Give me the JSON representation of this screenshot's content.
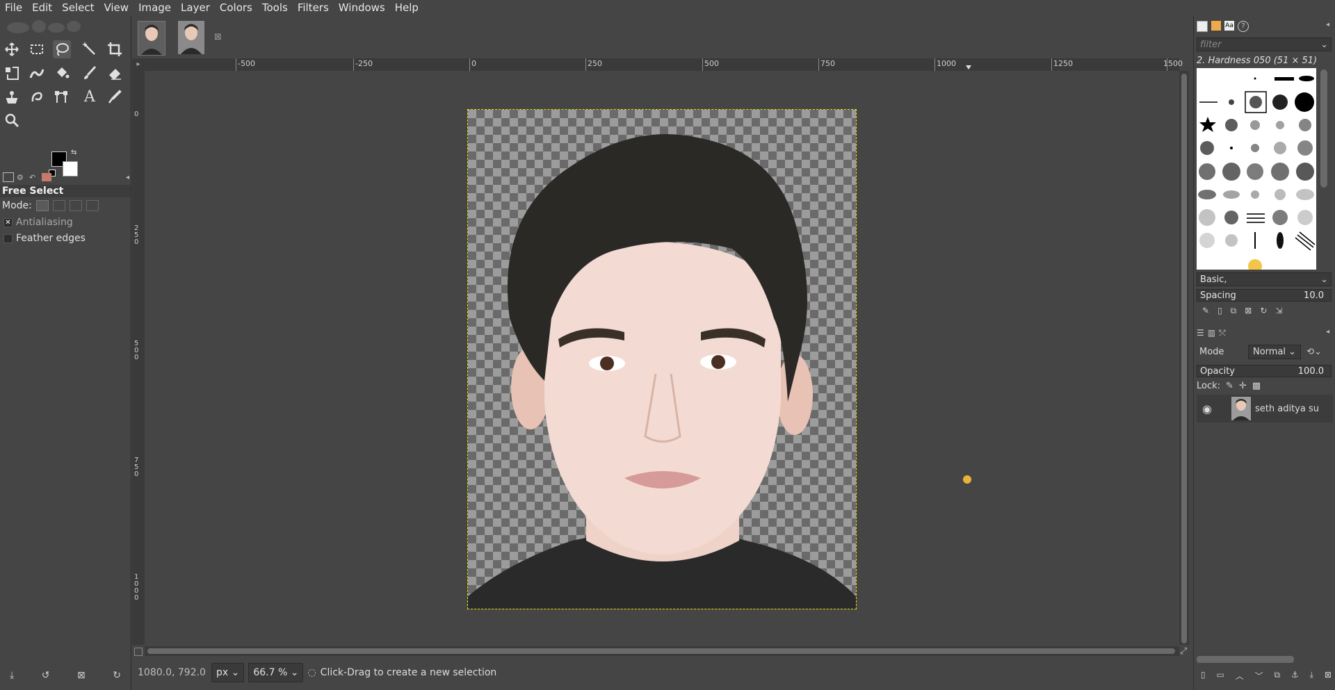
{
  "menu": [
    "File",
    "Edit",
    "Select",
    "View",
    "Image",
    "Layer",
    "Colors",
    "Tools",
    "Filters",
    "Windows",
    "Help"
  ],
  "toolbox": {
    "tools": [
      {
        "name": "move-tool",
        "icon": "move-icon"
      },
      {
        "name": "rect-select-tool",
        "icon": "rect-select-icon"
      },
      {
        "name": "free-select-tool",
        "icon": "lasso-icon",
        "active": true
      },
      {
        "name": "fuzzy-select-tool",
        "icon": "magic-wand-icon"
      },
      {
        "name": "crop-tool",
        "icon": "crop-icon"
      },
      {
        "name": "transform-tool",
        "icon": "transform-icon"
      },
      {
        "name": "warp-tool",
        "icon": "warp-icon"
      },
      {
        "name": "bucket-fill-tool",
        "icon": "bucket-icon"
      },
      {
        "name": "paintbrush-tool",
        "icon": "paintbrush-icon"
      },
      {
        "name": "eraser-tool",
        "icon": "eraser-icon"
      },
      {
        "name": "clone-tool",
        "icon": "clone-icon"
      },
      {
        "name": "smudge-tool",
        "icon": "smudge-icon"
      },
      {
        "name": "paths-tool",
        "icon": "paths-icon"
      },
      {
        "name": "text-tool",
        "icon": "text-icon"
      },
      {
        "name": "color-picker-tool",
        "icon": "color-picker-icon"
      },
      {
        "name": "zoom-tool",
        "icon": "zoom-icon"
      }
    ],
    "fg_color": "#000000",
    "bg_color": "#ffffff"
  },
  "tool_options": {
    "title": "Free Select",
    "mode_label": "Mode:",
    "antialiasing": {
      "label": "Antialiasing",
      "checked": true
    },
    "feather": {
      "label": "Feather edges",
      "checked": false
    }
  },
  "rulers": {
    "h_labels": [
      "-500",
      "-250",
      "0",
      "250",
      "500",
      "750",
      "1000",
      "1250",
      "1500"
    ],
    "v_labels": [
      "0",
      "250",
      "500",
      "750",
      "1000"
    ]
  },
  "statusbar": {
    "coords": "1080.0, 792.0",
    "unit": "px",
    "zoom": "66.7 %",
    "message": "Click-Drag to create a new selection"
  },
  "brushes": {
    "filter_placeholder": "filter",
    "selected": "2. Hardness 050 (51 × 51)",
    "tag": "Basic,",
    "spacing_label": "Spacing",
    "spacing_value": "10.0"
  },
  "layers": {
    "mode_label": "Mode",
    "mode_value": "Normal",
    "opacity_label": "Opacity",
    "opacity_value": "100.0",
    "lock_label": "Lock:",
    "items": [
      {
        "name": "seth aditya su",
        "visible": true
      }
    ]
  },
  "colors": {
    "accent": "#e8b33a",
    "selection": "#e6e600"
  }
}
